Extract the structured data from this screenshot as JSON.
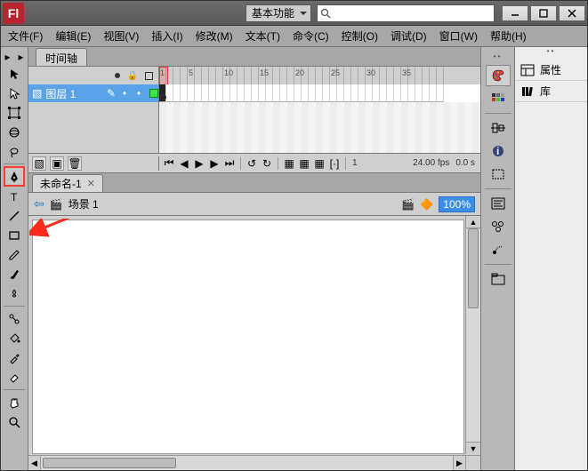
{
  "title": {
    "app_abbr": "Fl"
  },
  "workspace": {
    "label": "基本功能"
  },
  "search": {
    "placeholder": ""
  },
  "menu": {
    "file": "文件(F)",
    "edit": "编辑(E)",
    "view": "视图(V)",
    "insert": "插入(I)",
    "modify": "修改(M)",
    "text": "文本(T)",
    "commands": "命令(C)",
    "control": "控制(O)",
    "debug": "调试(D)",
    "window": "窗口(W)",
    "help": "帮助(H)"
  },
  "timeline": {
    "tab": "时间轴",
    "layer_name": "图层 1",
    "ruler_labels": [
      "1",
      "5",
      "10",
      "15",
      "20",
      "25",
      "30",
      "35"
    ],
    "current_frame": "1",
    "fps": "24.00 fps",
    "elapsed": "0.0 s"
  },
  "doc": {
    "tab_name": "未命名-1",
    "scene": "场景 1",
    "zoom": "100%"
  },
  "right": {
    "properties": "属性",
    "library": "库"
  }
}
